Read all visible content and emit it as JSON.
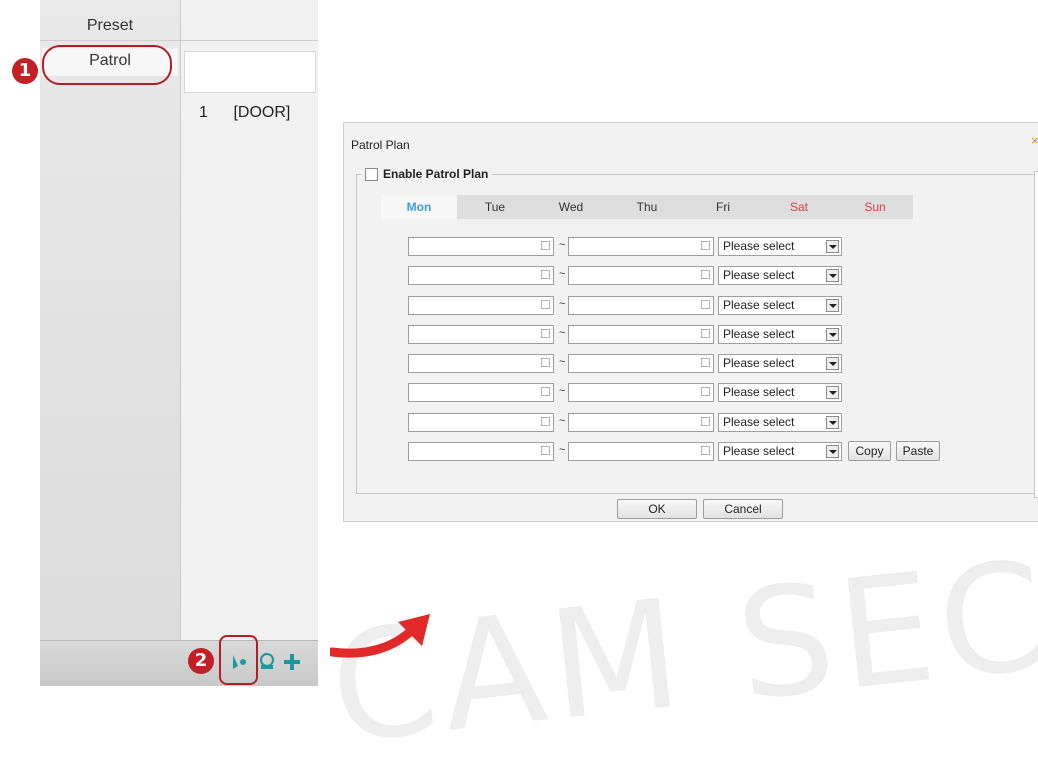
{
  "left_panel": {
    "header": "Preset",
    "tab_active": "Patrol",
    "list_rows": [
      {
        "index": "1",
        "name": "[DOOR]"
      }
    ]
  },
  "badges": {
    "one": "1",
    "two": "2"
  },
  "toolbar_icons": [
    "patrol-plan-icon",
    "record-track-icon",
    "add-icon"
  ],
  "dialog": {
    "title": "Patrol Plan",
    "close": "×",
    "enable_label": "Enable Patrol Plan",
    "enable_checked": false,
    "days": [
      "Mon",
      "Tue",
      "Wed",
      "Thu",
      "Fri",
      "Sat",
      "Sun"
    ],
    "active_day": "Mon",
    "tilde": "~",
    "rows": [
      {
        "start": "",
        "end": "",
        "select": "Please select"
      },
      {
        "start": "",
        "end": "",
        "select": "Please select"
      },
      {
        "start": "",
        "end": "",
        "select": "Please select"
      },
      {
        "start": "",
        "end": "",
        "select": "Please select"
      },
      {
        "start": "",
        "end": "",
        "select": "Please select"
      },
      {
        "start": "",
        "end": "",
        "select": "Please select"
      },
      {
        "start": "",
        "end": "",
        "select": "Please select"
      },
      {
        "start": "",
        "end": "",
        "select": "Please select"
      }
    ],
    "copy_label": "Copy",
    "paste_label": "Paste",
    "ok_label": "OK",
    "cancel_label": "Cancel"
  },
  "watermark": "CAM SECU",
  "colors": {
    "highlight": "#b02026",
    "active_day": "#3aa1d8",
    "weekend": "#d04545",
    "arrow": "#e02a2a"
  }
}
